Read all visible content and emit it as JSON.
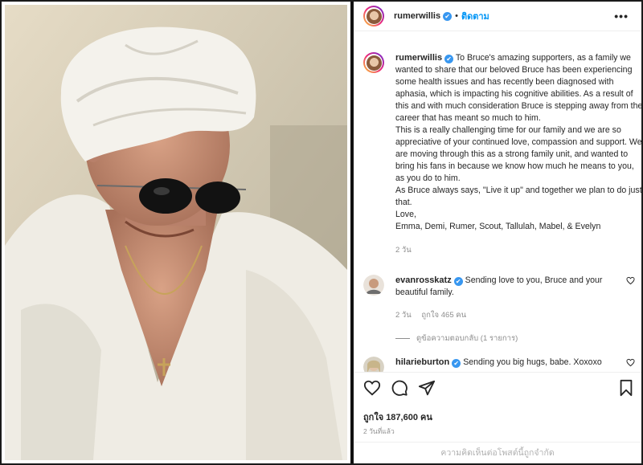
{
  "post": {
    "username": "rumerwillis",
    "verified_mark": "✔",
    "follow_label": "ติดตาม",
    "more_label": "•••",
    "caption_lines": [
      "To Bruce's amazing supporters, as a family we wanted to share that our beloved Bruce has been experiencing some health issues and has recently been diagnosed with aphasia, which is impacting his cognitive abilities. As a result of this and with much consideration Bruce is stepping away from the career that has meant so much to him.",
      "This is a really challenging time for our family and we are so appreciative of your continued love, compassion and support. We are moving through this as a strong family unit, and wanted to bring his fans in because we know how much he means to you, as you do to him.",
      "As Bruce always says, \"Live it up\" and together we plan to do just that.",
      "Love,",
      "Emma, Demi, Rumer, Scout, Tallulah, Mabel, & Evelyn"
    ],
    "caption_age": "2 วัน"
  },
  "comments": [
    {
      "username": "evanrosskatz",
      "text": "Sending love to you, Bruce and your beautiful family.",
      "age": "2 วัน",
      "likes": "ถูกใจ 465 คน",
      "replies": "ดูข้อความตอบกลับ (1 รายการ)"
    },
    {
      "username": "hilarieburton",
      "text": "Sending you big hugs, babe. Xoxoxo"
    }
  ],
  "actions": {
    "icons": [
      "heart-icon",
      "comment-icon",
      "share-icon",
      "bookmark-icon"
    ]
  },
  "likes_label": "ถูกใจ 187,600 คน",
  "timestamp": "2 วันที่แล้ว",
  "comments_disabled": "ความคิดเห็นต่อโพสต์นี้ถูกจำกัด",
  "colors": {
    "accent": "#0095f6",
    "verified": "#3897f0",
    "muted": "#8e8e8e",
    "text": "#262626"
  }
}
